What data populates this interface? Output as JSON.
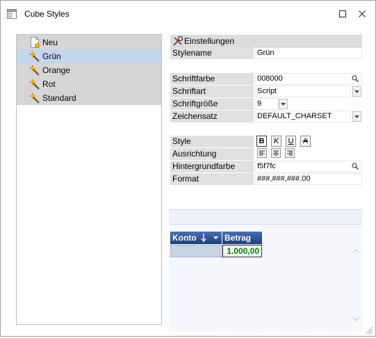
{
  "window": {
    "title": "Cube Styles"
  },
  "icons": {
    "app": "window-icon",
    "maximize": "maximize-icon",
    "close": "close-icon",
    "new_style": "new-document-icon",
    "style": "wand-icon",
    "settings": "tools-icon",
    "search": "magnifier-icon",
    "dropdown": "chevron-down-icon",
    "sort": "sort-down-icon"
  },
  "tree": {
    "items": [
      {
        "label": "Neu",
        "icon": "new-document-icon",
        "selected": false
      },
      {
        "label": "Grün",
        "icon": "wand-icon",
        "selected": true
      },
      {
        "label": "Orange",
        "icon": "wand-icon",
        "selected": false
      },
      {
        "label": "Rot",
        "icon": "wand-icon",
        "selected": false
      },
      {
        "label": "Standard",
        "icon": "wand-icon",
        "selected": false
      }
    ]
  },
  "settings": {
    "header": "Einstellungen",
    "stylename": {
      "label": "Stylename",
      "value": "Grün"
    },
    "schriftfarbe": {
      "label": "Schriftfarbe",
      "value": "008000"
    },
    "schriftart": {
      "label": "Schriftart",
      "value": "Script"
    },
    "schriftgroesse": {
      "label": "Schriftgröße",
      "value": "9"
    },
    "zeichensatz": {
      "label": "Zeichensatz",
      "value": "DEFAULT_CHARSET"
    },
    "style": {
      "label": "Style",
      "bold": "B",
      "italic": "K",
      "underline": "U",
      "strike": "A",
      "bold_active": true
    },
    "ausrichtung": {
      "label": "Ausrichtung"
    },
    "hintergrundfarbe": {
      "label": "Hintergrundfarbe",
      "value": "f5f7fc"
    },
    "format": {
      "label": "Format",
      "value": "###,###,###.00"
    }
  },
  "preview": {
    "columns": [
      "Konto",
      "Betrag"
    ],
    "cell_value": "1.000,00",
    "font_color": "#008000",
    "background_color": "#f5f7fc",
    "header_color": "#1f3f7a"
  }
}
